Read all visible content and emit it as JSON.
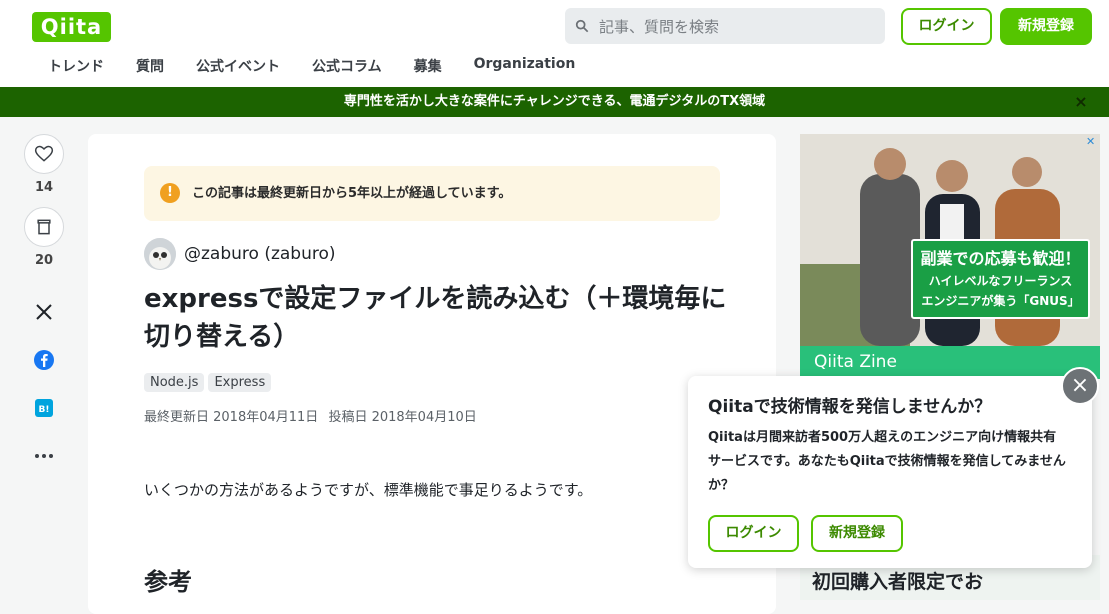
{
  "header": {
    "logo_text": "Qiita",
    "search_placeholder": "記事、質問を検索",
    "login_label": "ログイン",
    "signup_label": "新規登録",
    "nav": [
      "トレンド",
      "質問",
      "公式イベント",
      "公式コラム",
      "募集",
      "Organization"
    ]
  },
  "banner": {
    "text": "専門性を活かし大きな案件にチャレンジできる、電通デジタルのTX領域",
    "close": "×"
  },
  "rail": {
    "like_count": "14",
    "stock_count": "20"
  },
  "article": {
    "notice": "この記事は最終更新日から5年以上が経過しています。",
    "notice_icon": "!",
    "author": "@zaburo (zaburo)",
    "title": "expressで設定ファイルを読み込む（＋環境毎に切り替える）",
    "tags": [
      "Node.js",
      "Express"
    ],
    "updated": "最終更新日 2018年04月11日",
    "posted": "投稿日 2018年04月10日",
    "body_first_paragraph": "いくつかの方法があるようですが、標準機能で事足りるようです。",
    "section_heading": "参考"
  },
  "ad": {
    "callout_line1": "副業での応募も歓迎！",
    "callout_line2": "ハイレベルなフリーランス",
    "callout_line3": "エンジニアが集う「GNUS」",
    "footer_text": "Qiita Zine",
    "second_ad_text": "初回購入者限定でお"
  },
  "popup": {
    "title": "Qiitaで技術情報を発信しませんか？",
    "text": "Qiitaは月間来訪者500万人超えのエンジニア向け情報共有サービスです。あなたもQiitaで技術情報を発信してみませんか？",
    "login_label": "ログイン",
    "signup_label": "新規登録",
    "close": "×"
  },
  "colors": {
    "brand_green": "#55c500",
    "banner_green": "#1c6300",
    "notice_bg": "#fdf6e3",
    "notice_icon": "#f0a020"
  },
  "icons": [
    "search-icon",
    "heart-icon",
    "stock-icon",
    "x-icon",
    "facebook-icon",
    "hatena-bookmark-icon",
    "more-icon",
    "close-icon",
    "ad-choices-icon"
  ]
}
